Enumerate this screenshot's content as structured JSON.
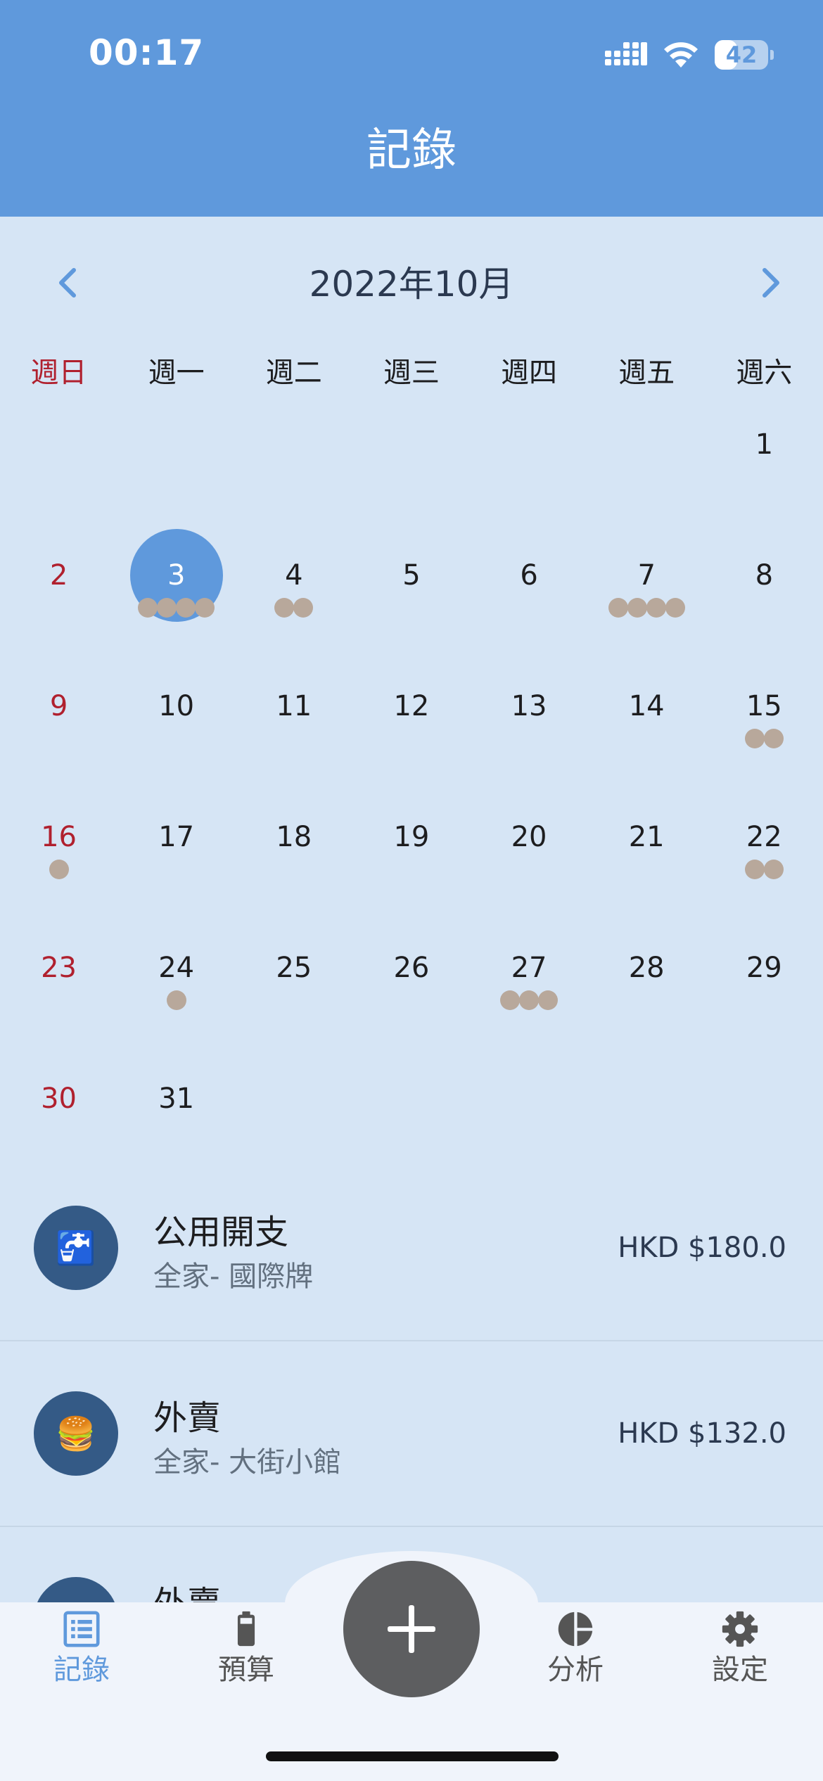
{
  "status_bar": {
    "time": "00:17",
    "battery_level": "42",
    "battery_fraction": 0.42
  },
  "header": {
    "title": "記錄"
  },
  "calendar": {
    "month_label": "2022年10月",
    "weekdays": [
      "週日",
      "週一",
      "週二",
      "週三",
      "週四",
      "週五",
      "週六"
    ],
    "selected_day": "3",
    "weeks": [
      [
        {
          "d": "",
          "n": 0
        },
        {
          "d": "",
          "n": 0
        },
        {
          "d": "",
          "n": 0
        },
        {
          "d": "",
          "n": 0
        },
        {
          "d": "",
          "n": 0
        },
        {
          "d": "",
          "n": 0
        },
        {
          "d": "1",
          "n": 0
        }
      ],
      [
        {
          "d": "2",
          "n": 0
        },
        {
          "d": "3",
          "n": 4
        },
        {
          "d": "4",
          "n": 2
        },
        {
          "d": "5",
          "n": 0
        },
        {
          "d": "6",
          "n": 0
        },
        {
          "d": "7",
          "n": 4
        },
        {
          "d": "8",
          "n": 0
        }
      ],
      [
        {
          "d": "9",
          "n": 0
        },
        {
          "d": "10",
          "n": 0
        },
        {
          "d": "11",
          "n": 0
        },
        {
          "d": "12",
          "n": 0
        },
        {
          "d": "13",
          "n": 0
        },
        {
          "d": "14",
          "n": 0
        },
        {
          "d": "15",
          "n": 2
        }
      ],
      [
        {
          "d": "16",
          "n": 1
        },
        {
          "d": "17",
          "n": 0
        },
        {
          "d": "18",
          "n": 0
        },
        {
          "d": "19",
          "n": 0
        },
        {
          "d": "20",
          "n": 0
        },
        {
          "d": "21",
          "n": 0
        },
        {
          "d": "22",
          "n": 2
        }
      ],
      [
        {
          "d": "23",
          "n": 0
        },
        {
          "d": "24",
          "n": 1
        },
        {
          "d": "25",
          "n": 0
        },
        {
          "d": "26",
          "n": 0
        },
        {
          "d": "27",
          "n": 3
        },
        {
          "d": "28",
          "n": 0
        },
        {
          "d": "29",
          "n": 0
        }
      ],
      [
        {
          "d": "30",
          "n": 0
        },
        {
          "d": "31",
          "n": 0
        },
        {
          "d": "",
          "n": 0
        },
        {
          "d": "",
          "n": 0
        },
        {
          "d": "",
          "n": 0
        },
        {
          "d": "",
          "n": 0
        },
        {
          "d": "",
          "n": 0
        }
      ]
    ]
  },
  "records": [
    {
      "icon": "🚰",
      "icon_name": "water-tap-icon",
      "title": "公用開支",
      "subtitle": "全家- 國際牌",
      "amount": "HKD $180.0"
    },
    {
      "icon": "🍔",
      "icon_name": "burger-icon",
      "title": "外賣",
      "subtitle": "全家- 大街小館",
      "amount": "HKD $132.0"
    },
    {
      "icon": "",
      "icon_name": "record-icon",
      "title": "外賣",
      "subtitle": "",
      "amount": ""
    }
  ],
  "tabbar": {
    "tabs": [
      {
        "label": "記錄",
        "icon": "list-icon",
        "active": true
      },
      {
        "label": "預算",
        "icon": "battery-icon",
        "active": false
      },
      {
        "label": "分析",
        "icon": "pie-chart-icon",
        "active": false
      },
      {
        "label": "設定",
        "icon": "gear-icon",
        "active": false
      }
    ],
    "add_icon": "plus-icon"
  },
  "colors": {
    "header": "#5f99dc",
    "background": "#d6e5f5",
    "accent": "#5f99dc",
    "sunday": "#b0202e",
    "dot": "#b8a89b",
    "record_icon_bg": "#345a86",
    "add_button": "#5d5e60"
  }
}
